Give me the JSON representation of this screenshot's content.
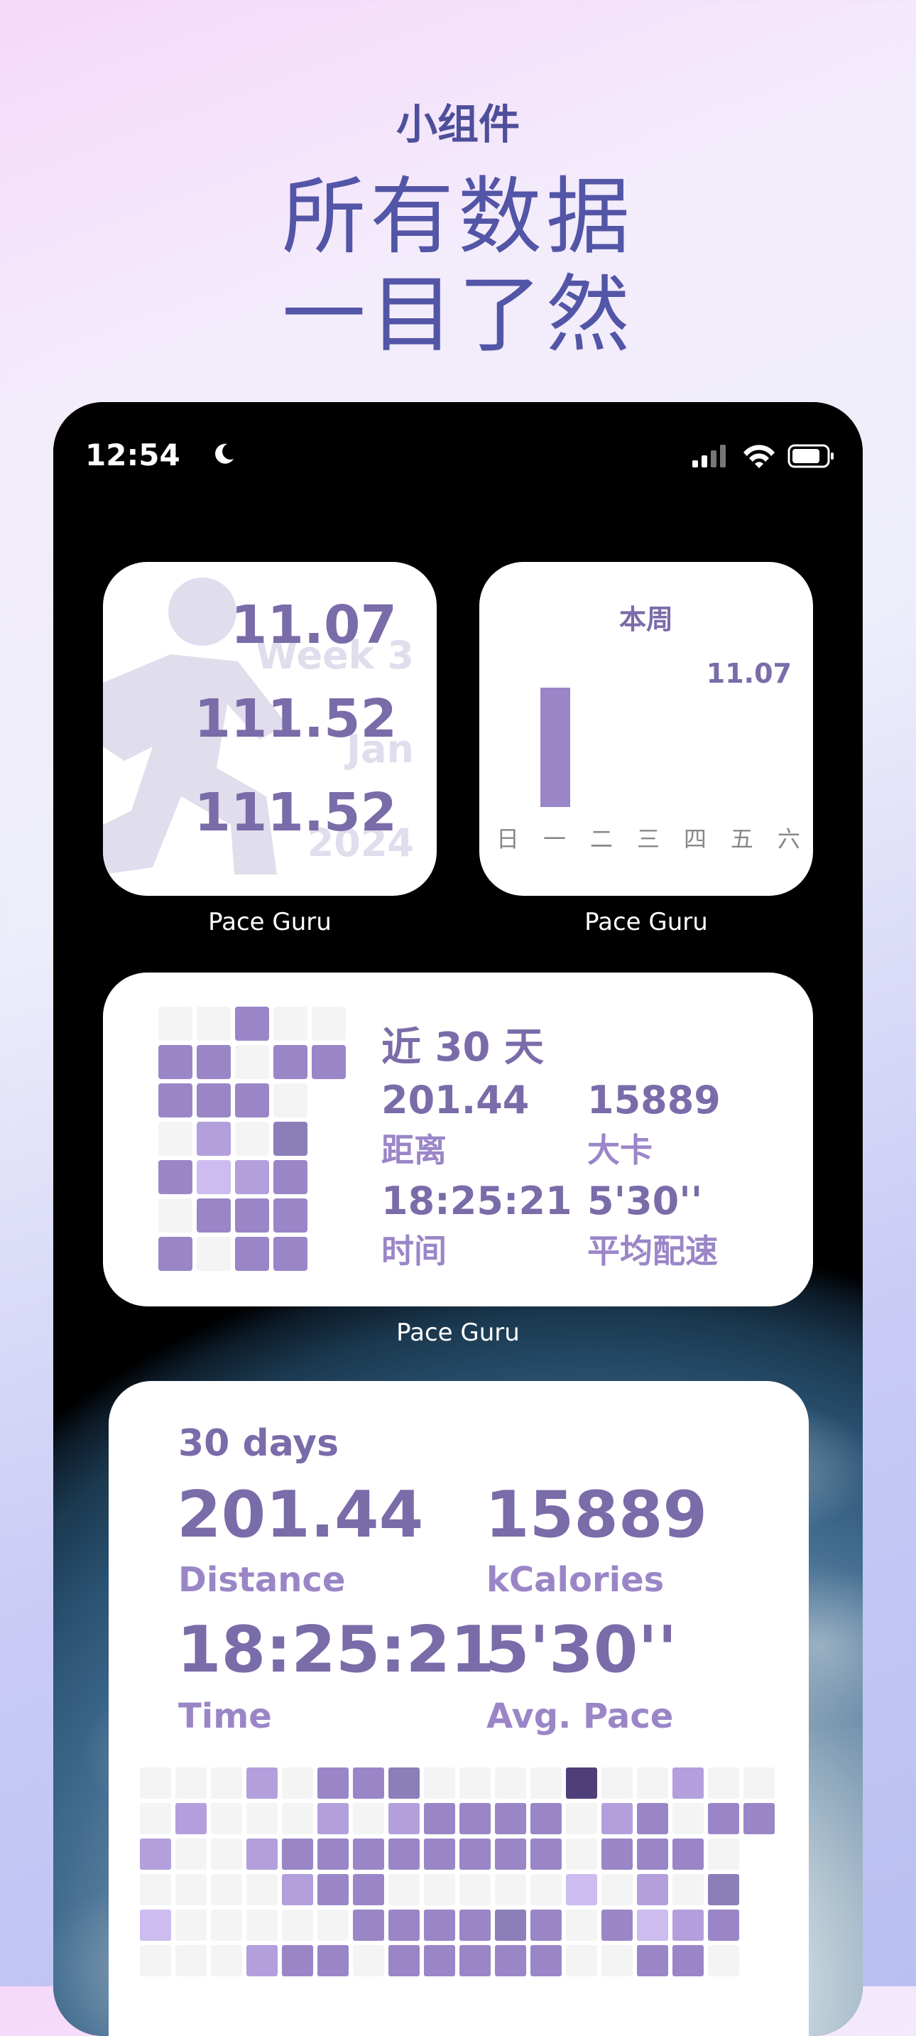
{
  "hero": {
    "subtitle": "小组件",
    "title_line1": "所有数据",
    "title_line2": "一目了然"
  },
  "status_bar": {
    "time": "12:54",
    "icons": [
      "moon-icon",
      "signal-icon",
      "wifi-icon",
      "battery-icon"
    ]
  },
  "widget_small_1": {
    "values": [
      "11.07",
      "111.52",
      "111.52"
    ],
    "ghost": [
      "Week 3",
      "Jan",
      "2024"
    ],
    "icon": "runner-icon",
    "caption": "Pace Guru"
  },
  "widget_small_2": {
    "title": "本周",
    "value_label": "11.07",
    "days": [
      "日",
      "一",
      "二",
      "三",
      "四",
      "五",
      "六"
    ],
    "values": [
      0,
      11.07,
      0,
      0,
      0,
      0,
      0
    ],
    "caption": "Pace Guru"
  },
  "widget_medium": {
    "heading": "近 30 天",
    "distance_value": "201.44",
    "distance_label": "距离",
    "calories_value": "15889",
    "calories_label": "大卡",
    "time_value": "18:25:21",
    "time_label": "时间",
    "pace_value": "5'30''",
    "pace_label": "平均配速",
    "caption": "Pace Guru"
  },
  "widget_large": {
    "heading": "30 days",
    "distance_value": "201.44",
    "distance_label": "Distance",
    "calories_value": "15889",
    "calories_label": "kCalories",
    "time_value": "18:25:21",
    "time_label": "Time",
    "pace_value": "5'30''",
    "pace_label": "Avg. Pace"
  },
  "colors": {
    "empty": "#f4f4f4",
    "light": "#cdbcef",
    "mid": "#b49fdd",
    "strong": "#9a86c7",
    "dark": "#8c7fb9",
    "deep": "#4f3f78",
    "accent_text": "#7a6ba9"
  }
}
